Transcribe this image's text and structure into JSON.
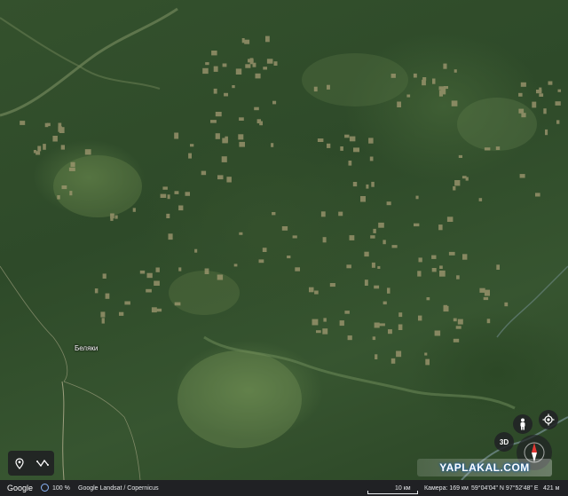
{
  "map": {
    "place_label": "Беляки",
    "colors": {
      "forest": "#2f4a2a",
      "clearing": "#a39a72",
      "road": "#c9bfa0",
      "river": "#6f8a88"
    }
  },
  "controls": {
    "three_d_label": "3D",
    "pegman_icon": "pegman-icon",
    "locate_icon": "my-location-icon",
    "compass_icon": "compass-icon",
    "place_tool_icon": "map-pin-icon",
    "path_tool_icon": "path-icon"
  },
  "watermark": "YAPLAKAL.COM",
  "statusbar": {
    "brand": "Google",
    "loading_percent": "100 %",
    "attribution": "Google  Landsat / Copernicus",
    "scale": "10 км",
    "camera": "Камера: 169 км",
    "coordinates": "59°04'04\" N 97°52'48\" E",
    "elevation": "421 м"
  }
}
